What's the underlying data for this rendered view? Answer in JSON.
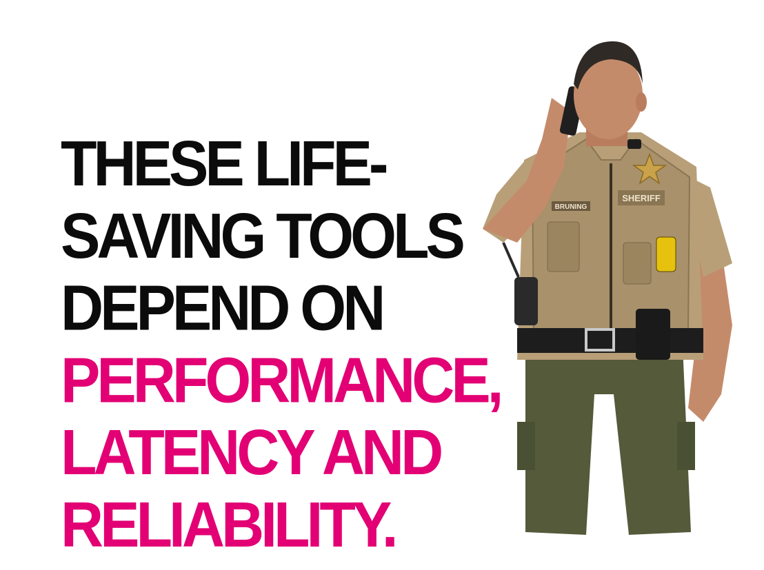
{
  "headline": {
    "lines_dark": [
      "THESE LIFE-",
      "SAVING TOOLS",
      "DEPEND ON"
    ],
    "lines_accent": [
      "PERFORMANCE,",
      "LATENCY AND",
      "RELIABILITY."
    ]
  },
  "photo": {
    "subject": "officer-on-phone",
    "name_tag": "BRUNING",
    "badge_text": "SHERIFF"
  },
  "colors": {
    "dark_text": "#0b0b0b",
    "accent": "#e20074",
    "background": "#ffffff",
    "shirt": "#b89f78",
    "vest": "#a8916b",
    "pants": "#545a3a",
    "skin": "#c48b6a"
  }
}
